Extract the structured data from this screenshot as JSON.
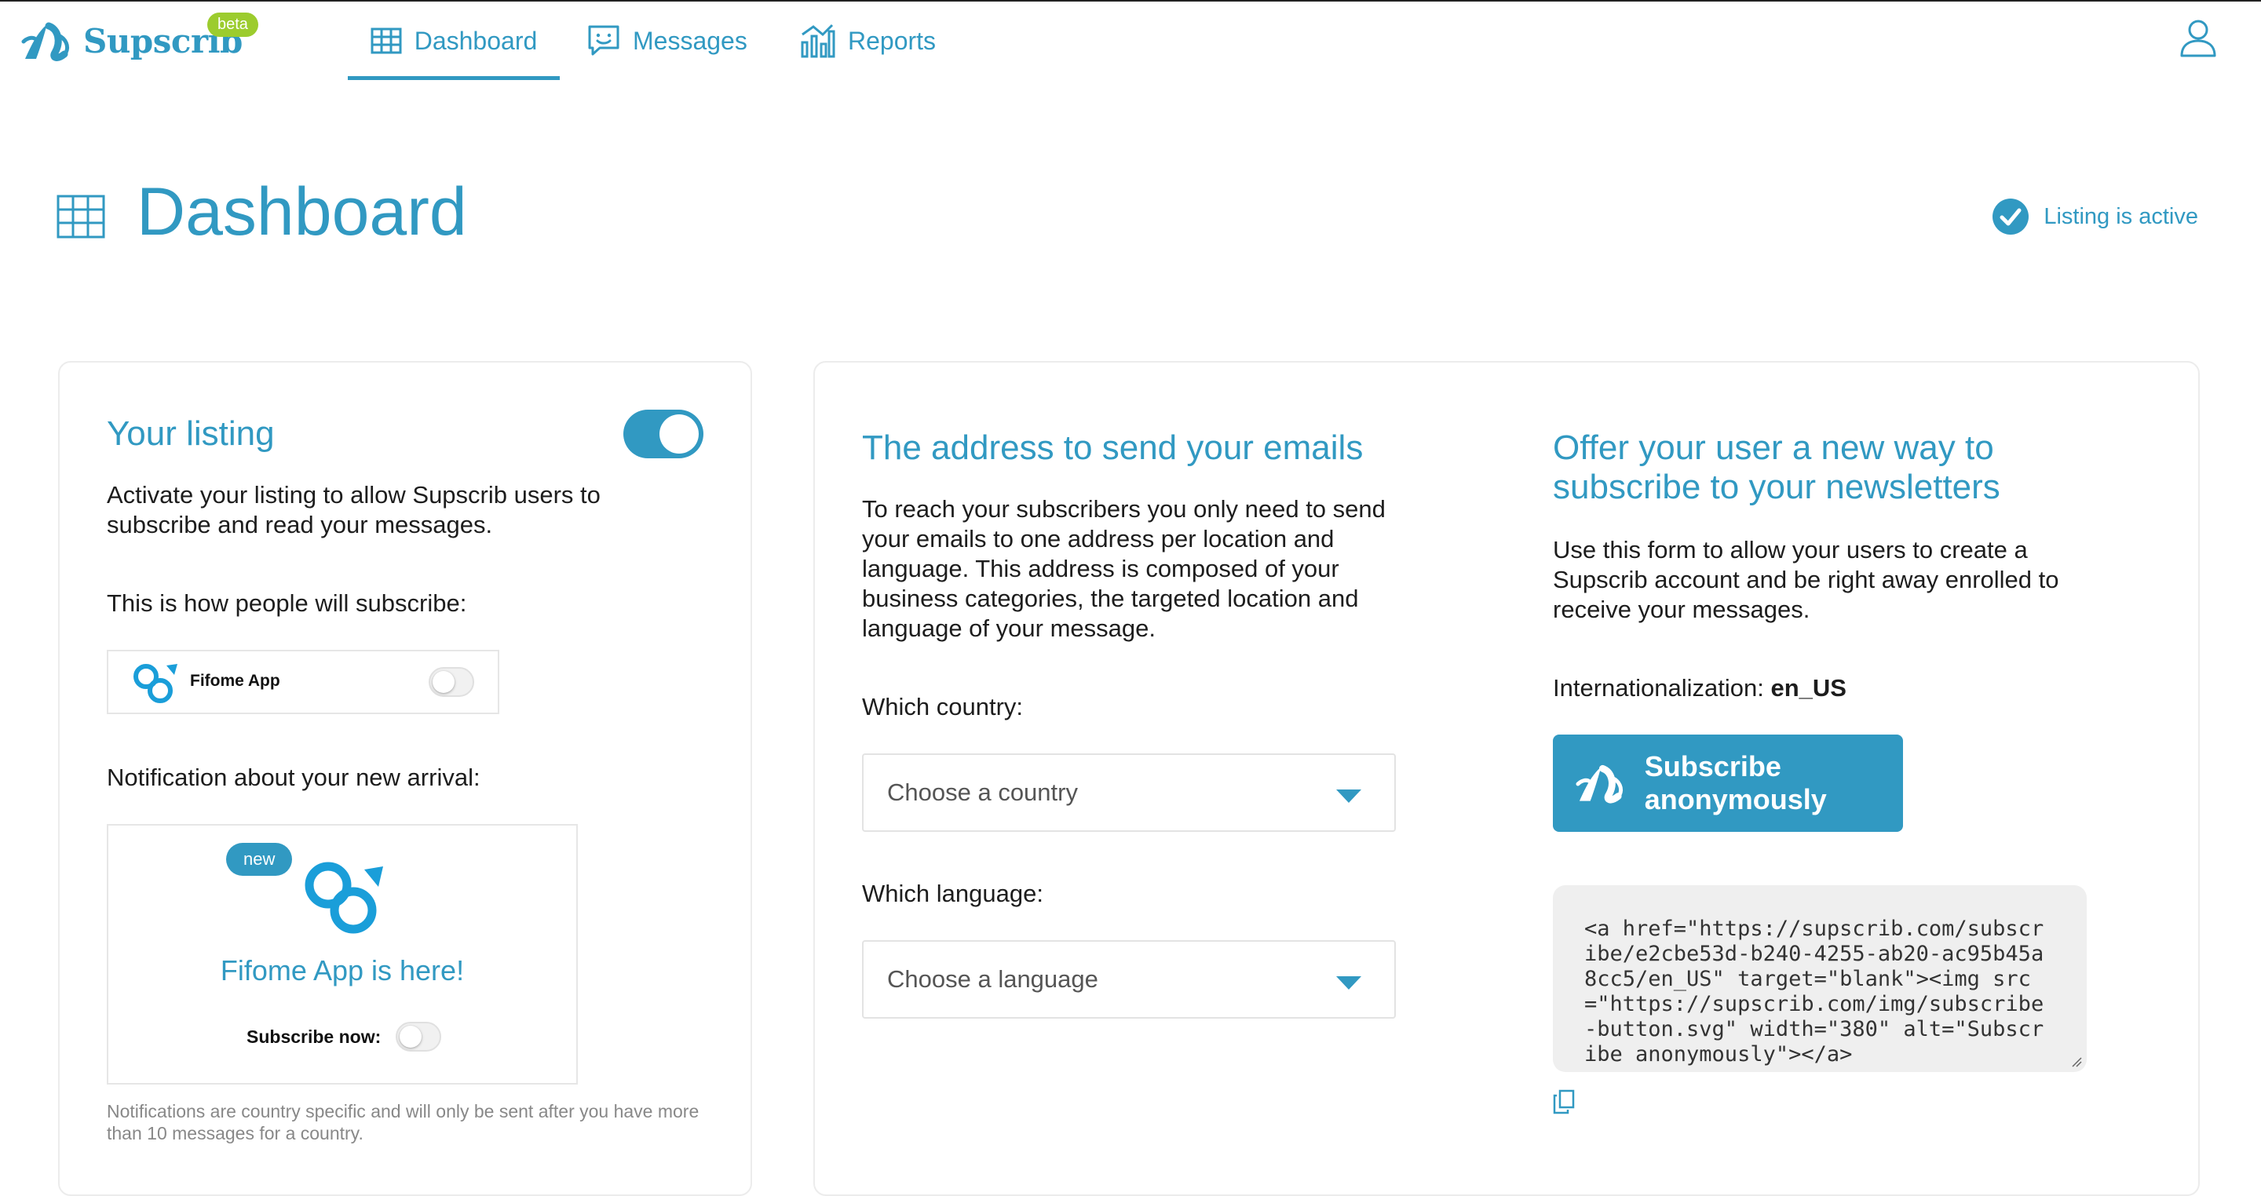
{
  "nav": {
    "brand": "Supscrib",
    "beta_badge": "beta",
    "tabs": [
      {
        "label": "Dashboard",
        "icon": "grid-icon",
        "active": true
      },
      {
        "label": "Messages",
        "icon": "chat-icon",
        "active": false
      },
      {
        "label": "Reports",
        "icon": "bar-chart-icon",
        "active": false
      }
    ],
    "user_icon": "user-icon"
  },
  "page": {
    "title": "Dashboard",
    "status": "Listing is active"
  },
  "listing_card": {
    "title": "Your listing",
    "toggle_on": true,
    "description": "Activate your listing to allow Supscrib users to subscribe and read your messages.",
    "how_label": "This is how people will subscribe:",
    "app_name": "Fifome App",
    "notification_label": "Notification about your new arrival:",
    "new_badge": "new",
    "notification_title": "Fifome App is here!",
    "subscribe_now": "Subscribe now:",
    "footnote": "Notifications are country specific and will only be sent after you have more than 10 messages for a country."
  },
  "address_card": {
    "title": "The address to send your emails",
    "description": "To reach your subscribers you only need to send your emails to one address per location and language. This address is composed of your business categories, the targeted location and language of your message.",
    "country_label": "Which country:",
    "country_placeholder": "Choose a country",
    "language_label": "Which language:",
    "language_placeholder": "Choose a language"
  },
  "offer_card": {
    "title": "Offer your user a new way to subscribe to your newsletters",
    "description": "Use this form to allow your users to create a Supscrib account and be right away enrolled to receive your messages.",
    "i18n_label": "Internationalization:",
    "i18n_value": "en_US",
    "button_label": "Subscribe anonymously",
    "embed_code": "<a href=\"https://supscrib.com/subscribe/e2cbe53d-b240-4255-ab20-ac95b45a8cc5/en_US\" target=\"blank\"><img src=\"https://supscrib.com/img/subscribe-button.svg\" width=\"380\" alt=\"Subscribe anonymously\"></a>",
    "copy_icon": "copy-icon"
  },
  "colors": {
    "accent": "#3199c2",
    "beta": "#9ccc2e",
    "code_bg": "#efefef"
  }
}
